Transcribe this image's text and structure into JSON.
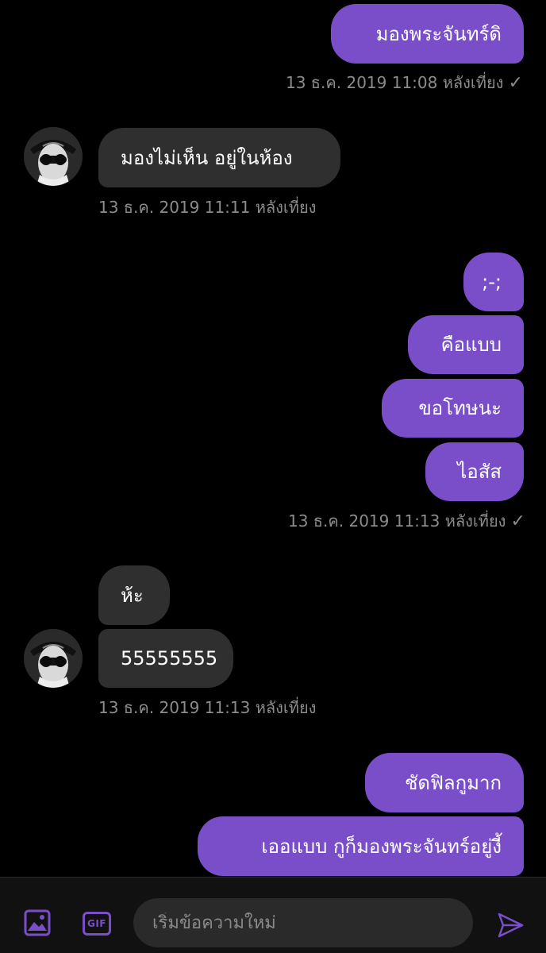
{
  "messages": [
    {
      "direction": "outgoing",
      "text": "มองพระจันทร์ดิ"
    },
    {
      "direction": "outgoing",
      "timestamp": "13 ธ.ค. 2019 11:08 หลังเที่ยง",
      "status": "✓"
    },
    {
      "direction": "incoming",
      "text": "มองไม่เห็น อยู่ในห้อง"
    },
    {
      "direction": "incoming",
      "timestamp": "13 ธ.ค. 2019 11:11 หลังเที่ยง"
    },
    {
      "direction": "outgoing",
      "text": ";-;"
    },
    {
      "direction": "outgoing",
      "text": "คือแบบ"
    },
    {
      "direction": "outgoing",
      "text": "ขอโทษนะ"
    },
    {
      "direction": "outgoing",
      "text": "ไอสัส"
    },
    {
      "direction": "outgoing",
      "timestamp": "13 ธ.ค. 2019 11:13 หลังเที่ยง",
      "status": "✓"
    },
    {
      "direction": "incoming",
      "text": "ห้ะ"
    },
    {
      "direction": "incoming",
      "text": "55555555"
    },
    {
      "direction": "incoming",
      "timestamp": "13 ธ.ค. 2019 11:13 หลังเที่ยง"
    },
    {
      "direction": "outgoing",
      "text": "ชัดฟิลกูมาก"
    },
    {
      "direction": "outgoing",
      "text": "เออแบบ กูก็มองพระจันทร์อยู่งี้"
    }
  ],
  "composer": {
    "placeholder": "เริ่มข้อความใหม่",
    "gif_label": "GIF",
    "image_icon": "image-icon",
    "send_icon": "send-icon"
  },
  "colors": {
    "outgoing_bubble": "#7a4ec9",
    "incoming_bubble": "#2f2f2f",
    "background": "#000000",
    "timestamp": "#8b8b8b",
    "accent": "#7a4ec9"
  }
}
